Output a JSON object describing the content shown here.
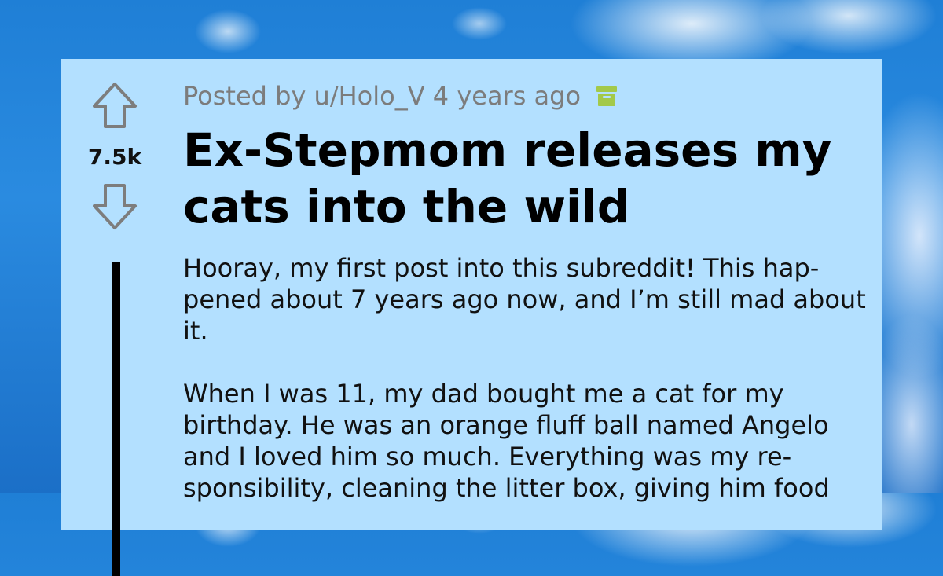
{
  "post": {
    "score": "7.5k",
    "meta": {
      "posted_by": "Posted by u/Holo_V 4 years ago",
      "archived_icon": "archive-box-icon"
    },
    "title": "Ex-Stepmom releases my cats into the wild",
    "body": [
      "Hooray, my first post into this subreddit! This hap-pened about 7 years ago now, and I’m still mad about it.",
      "When I was 11, my dad bought me a cat for my birthday. He was an orange fluff ball named Angelo and I loved him so much. Everything was my re-sponsibility, cleaning the litter box, giving him food"
    ]
  },
  "colors": {
    "card_bg": "#b3e0ff",
    "meta_text": "#7c7c7c",
    "archive_icon": "#a3c94a",
    "sky": "#1f7fd6"
  },
  "icons": {
    "upvote": "upvote-arrow-icon",
    "downvote": "downvote-arrow-icon"
  }
}
